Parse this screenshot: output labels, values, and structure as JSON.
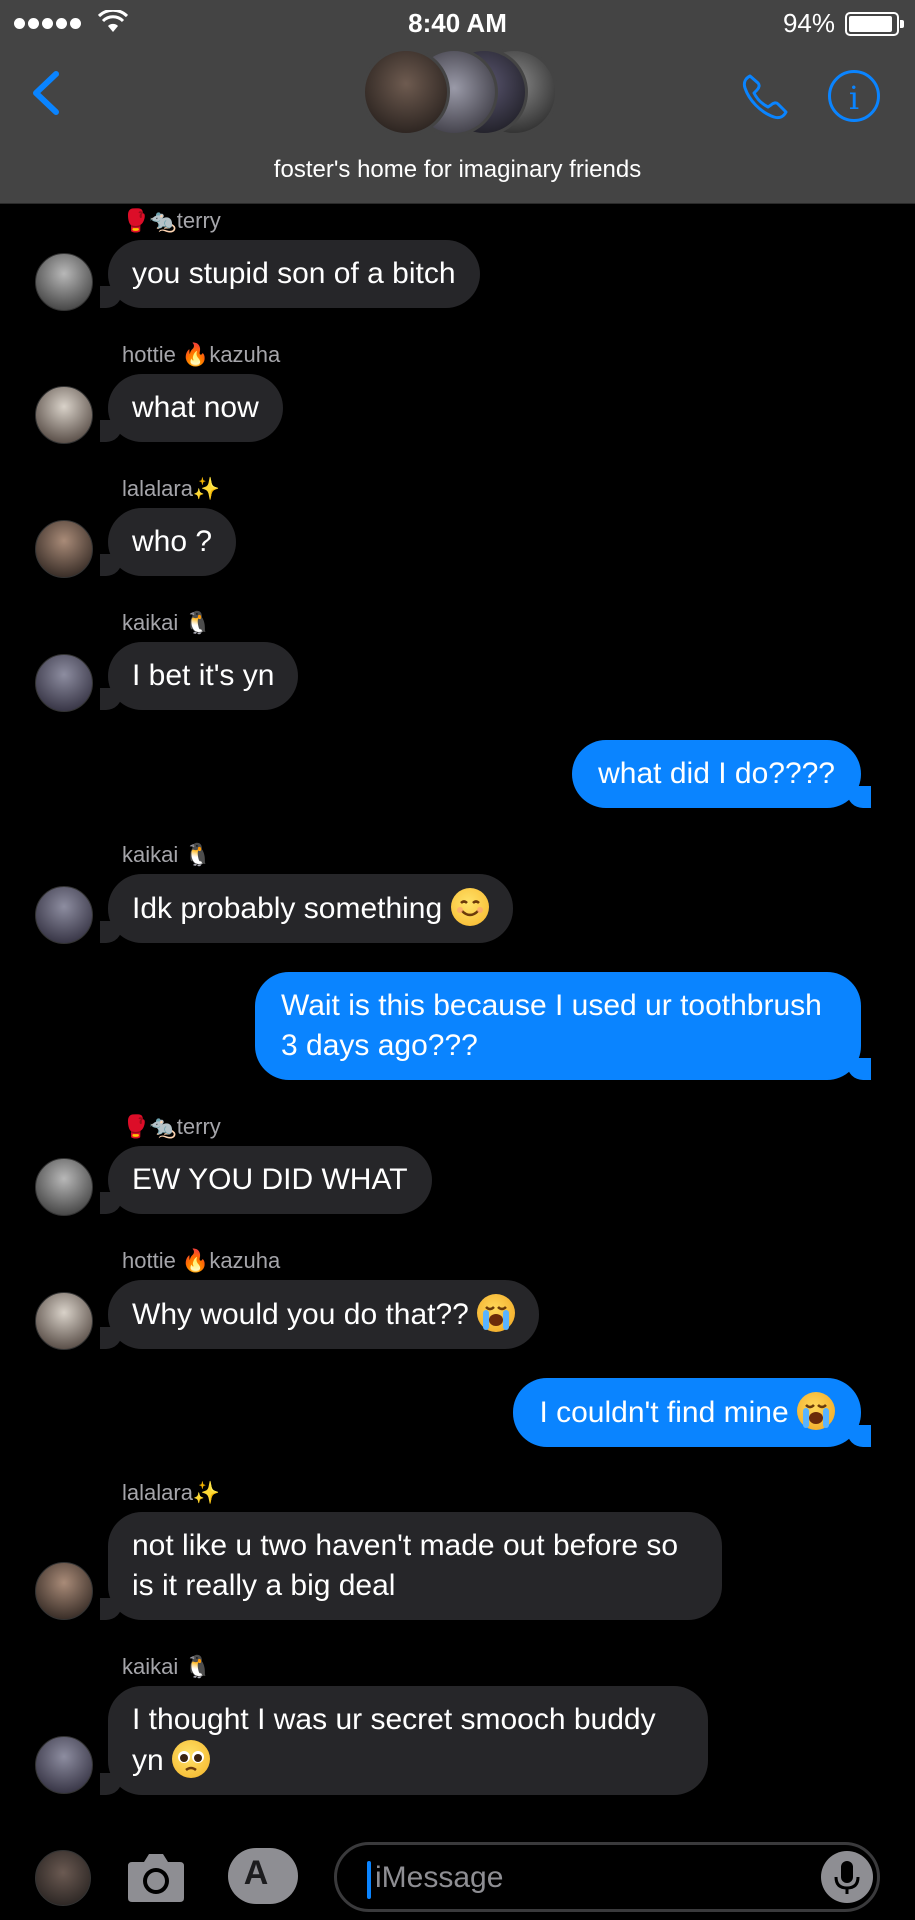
{
  "status_bar": {
    "time": "8:40 AM",
    "battery": "94%"
  },
  "header": {
    "group_name": "foster's home for imaginary friends"
  },
  "messages": [
    {
      "sender": "🥊🐀terry",
      "text": "you stupid son of a bitch"
    },
    {
      "sender": "hottie 🔥kazuha",
      "text": "what now"
    },
    {
      "sender": "lalalara✨",
      "text": "who ?"
    },
    {
      "sender": "kaikai 🐧",
      "text": "I bet it's yn"
    },
    {
      "text": "what did I do????"
    },
    {
      "sender": "kaikai 🐧",
      "text": "Idk probably something"
    },
    {
      "text": "Wait is this because I used ur toothbrush 3 days ago???"
    },
    {
      "sender": "🥊🐀terry",
      "text": "EW YOU DID WHAT"
    },
    {
      "sender": "hottie 🔥kazuha",
      "text": "Why would you do that??"
    },
    {
      "text": "I couldn't find mine"
    },
    {
      "sender": "lalalara✨",
      "text": "not like u two haven't made out before so is it really a big deal"
    },
    {
      "sender": "kaikai 🐧",
      "text": "I thought I was ur secret smooch buddy yn"
    }
  ],
  "input": {
    "placeholder": "iMessage"
  },
  "colors": {
    "accent": "#0a84ff",
    "incoming_bubble": "#262629",
    "header_bg": "#444444",
    "background": "#000000"
  }
}
